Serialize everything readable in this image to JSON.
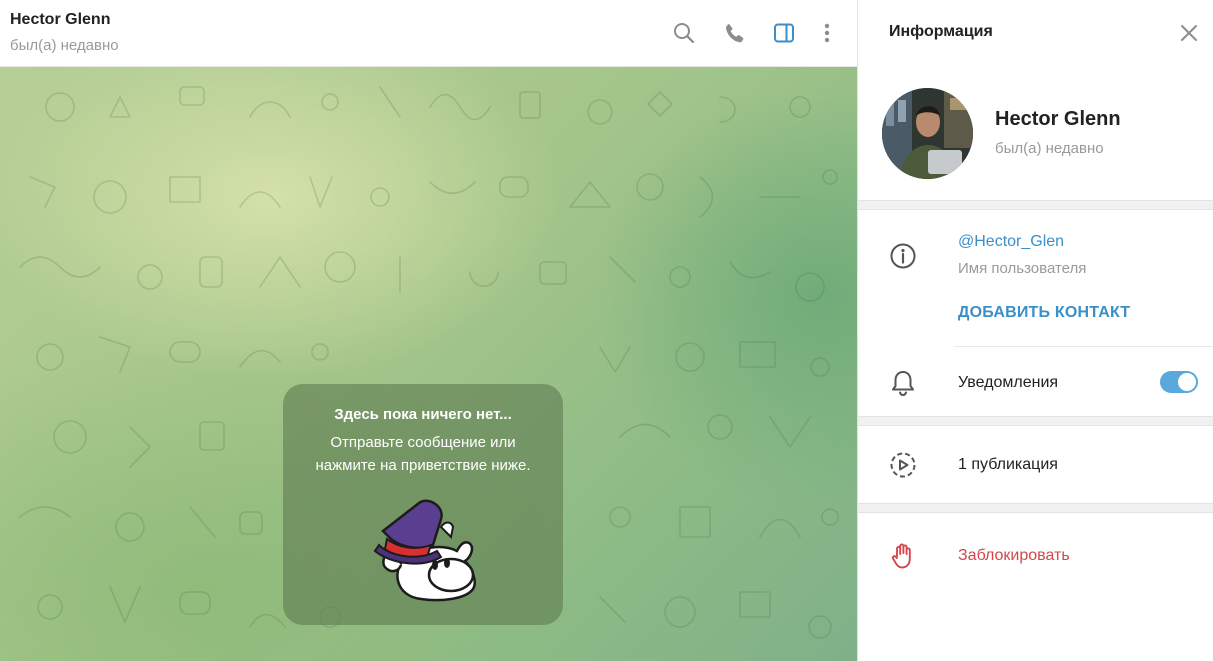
{
  "chat": {
    "name": "Hector Glenn",
    "status": "был(а) недавно",
    "header_icons": [
      "search-icon",
      "phone-icon",
      "sidebar-toggle-icon",
      "more-vertical-icon"
    ],
    "empty": {
      "title": "Здесь пока ничего нет...",
      "line1": "Отправьте сообщение или",
      "line2": "нажмите на приветствие ниже."
    }
  },
  "info": {
    "title": "Информация",
    "profile": {
      "name": "Hector Glenn",
      "status": "был(а) недавно"
    },
    "username": "@Hector_Glen",
    "username_label": "Имя пользователя",
    "add_contact": "ДОБАВИТЬ КОНТАКТ",
    "notifications_label": "Уведомления",
    "notifications_enabled": true,
    "publications": "1 публикация",
    "block": "Заблокировать"
  },
  "colors": {
    "accent": "#3a8fc9",
    "danger": "#d3474c",
    "toggle_on": "#5aa8dc",
    "muted_text": "#9a9a9a"
  }
}
